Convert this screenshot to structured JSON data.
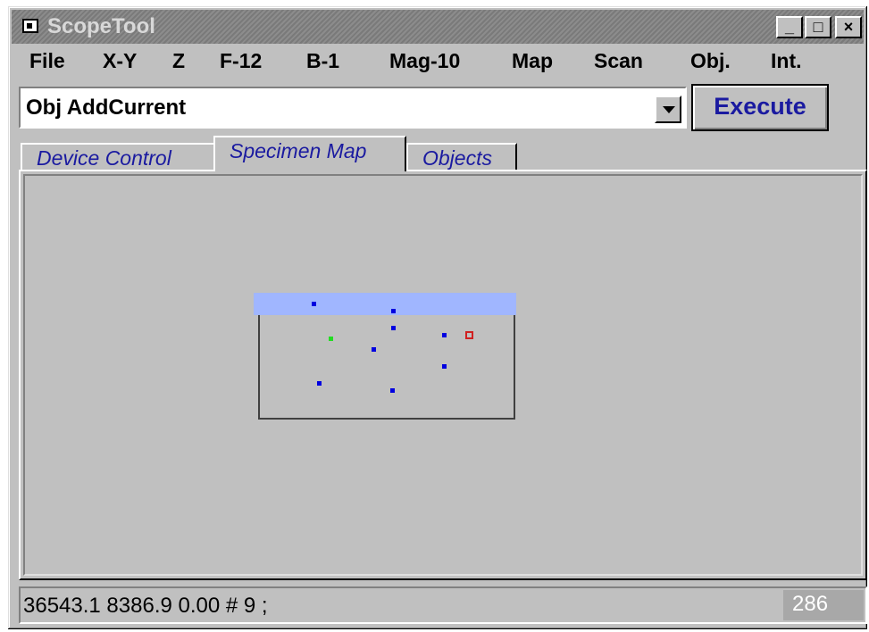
{
  "window": {
    "title": "ScopeTool",
    "controls": {
      "minimize": "_",
      "maximize": "□",
      "close": "×"
    }
  },
  "menu": {
    "items": [
      "File",
      "X-Y",
      "Z",
      "F-12",
      "B-1",
      "Mag-10",
      "Map",
      "Scan",
      "Obj.",
      "Int."
    ]
  },
  "command": {
    "value": "Obj AddCurrent",
    "execute_label": "Execute"
  },
  "tabs": [
    {
      "label": "Device Control",
      "active": false
    },
    {
      "label": "Specimen Map",
      "active": true
    },
    {
      "label": "Objects",
      "active": false
    }
  ],
  "map": {
    "objects": [
      {
        "color": "blue"
      },
      {
        "color": "blue"
      },
      {
        "color": "blue"
      },
      {
        "color": "green"
      },
      {
        "color": "blue"
      },
      {
        "color": "blue"
      },
      {
        "color": "blue"
      },
      {
        "color": "blue"
      },
      {
        "color": "blue"
      }
    ],
    "current_marker_color": "#d02020",
    "band_color": "#a0b6ff"
  },
  "status": {
    "text": "36543.1 8386.9 0.00 # 9 ;",
    "count": "286"
  }
}
